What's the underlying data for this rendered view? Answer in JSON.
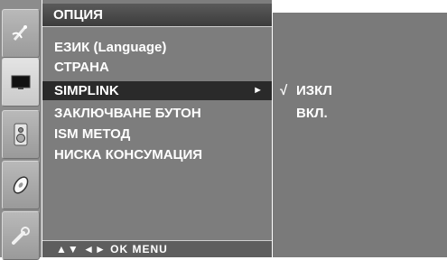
{
  "menu": {
    "title": "ОПЦИЯ",
    "items": [
      {
        "label": "ЕЗИК (Language)",
        "selected": false
      },
      {
        "label": "СТРАНА",
        "selected": false
      },
      {
        "label": "SIMPLINK",
        "selected": true,
        "arrow": "►"
      },
      {
        "label": "ЗАКЛЮЧВАНЕ БУТОН",
        "selected": false
      },
      {
        "label": "ISM МЕТОД",
        "selected": false
      },
      {
        "label": "НИСКА КОНСУМАЦИЯ",
        "selected": false
      }
    ],
    "footer": "▲▼ ◄► OK  MENU"
  },
  "submenu": {
    "items": [
      {
        "label": "ИЗКЛ",
        "check": "√",
        "checked": true
      },
      {
        "label": "ВКЛ.",
        "check": "",
        "checked": false
      }
    ]
  },
  "sidebar": {
    "icons": [
      {
        "name": "satellite-dish-icon",
        "active": false
      },
      {
        "name": "screen-icon",
        "active": true
      },
      {
        "name": "speaker-icon",
        "active": false
      },
      {
        "name": "disc-icon",
        "active": false
      },
      {
        "name": "wrench-icon",
        "active": false
      }
    ]
  },
  "colors": {
    "panel": "#7d7d7d",
    "selected_row": "#2a2a2a",
    "text": "#ffffff"
  }
}
